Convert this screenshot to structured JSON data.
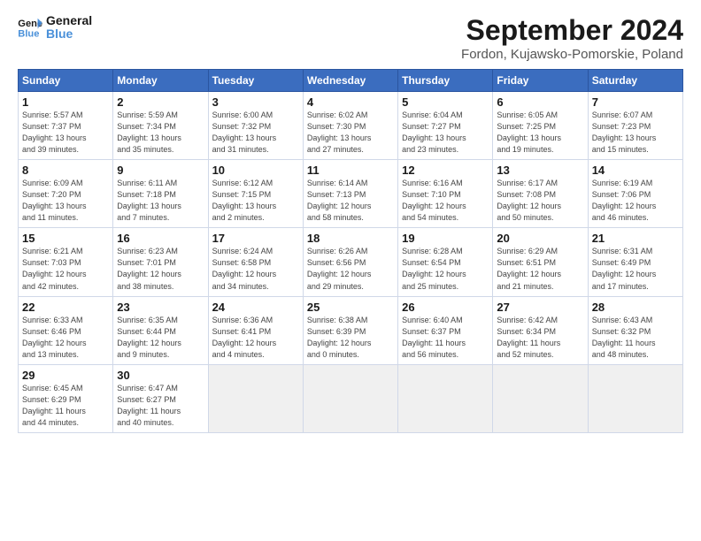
{
  "logo": {
    "line1": "General",
    "line2": "Blue"
  },
  "title": "September 2024",
  "subtitle": "Fordon, Kujawsko-Pomorskie, Poland",
  "weekdays": [
    "Sunday",
    "Monday",
    "Tuesday",
    "Wednesday",
    "Thursday",
    "Friday",
    "Saturday"
  ],
  "weeks": [
    [
      {
        "day": "1",
        "info": "Sunrise: 5:57 AM\nSunset: 7:37 PM\nDaylight: 13 hours\nand 39 minutes."
      },
      {
        "day": "2",
        "info": "Sunrise: 5:59 AM\nSunset: 7:34 PM\nDaylight: 13 hours\nand 35 minutes."
      },
      {
        "day": "3",
        "info": "Sunrise: 6:00 AM\nSunset: 7:32 PM\nDaylight: 13 hours\nand 31 minutes."
      },
      {
        "day": "4",
        "info": "Sunrise: 6:02 AM\nSunset: 7:30 PM\nDaylight: 13 hours\nand 27 minutes."
      },
      {
        "day": "5",
        "info": "Sunrise: 6:04 AM\nSunset: 7:27 PM\nDaylight: 13 hours\nand 23 minutes."
      },
      {
        "day": "6",
        "info": "Sunrise: 6:05 AM\nSunset: 7:25 PM\nDaylight: 13 hours\nand 19 minutes."
      },
      {
        "day": "7",
        "info": "Sunrise: 6:07 AM\nSunset: 7:23 PM\nDaylight: 13 hours\nand 15 minutes."
      }
    ],
    [
      {
        "day": "8",
        "info": "Sunrise: 6:09 AM\nSunset: 7:20 PM\nDaylight: 13 hours\nand 11 minutes."
      },
      {
        "day": "9",
        "info": "Sunrise: 6:11 AM\nSunset: 7:18 PM\nDaylight: 13 hours\nand 7 minutes."
      },
      {
        "day": "10",
        "info": "Sunrise: 6:12 AM\nSunset: 7:15 PM\nDaylight: 13 hours\nand 2 minutes."
      },
      {
        "day": "11",
        "info": "Sunrise: 6:14 AM\nSunset: 7:13 PM\nDaylight: 12 hours\nand 58 minutes."
      },
      {
        "day": "12",
        "info": "Sunrise: 6:16 AM\nSunset: 7:10 PM\nDaylight: 12 hours\nand 54 minutes."
      },
      {
        "day": "13",
        "info": "Sunrise: 6:17 AM\nSunset: 7:08 PM\nDaylight: 12 hours\nand 50 minutes."
      },
      {
        "day": "14",
        "info": "Sunrise: 6:19 AM\nSunset: 7:06 PM\nDaylight: 12 hours\nand 46 minutes."
      }
    ],
    [
      {
        "day": "15",
        "info": "Sunrise: 6:21 AM\nSunset: 7:03 PM\nDaylight: 12 hours\nand 42 minutes."
      },
      {
        "day": "16",
        "info": "Sunrise: 6:23 AM\nSunset: 7:01 PM\nDaylight: 12 hours\nand 38 minutes."
      },
      {
        "day": "17",
        "info": "Sunrise: 6:24 AM\nSunset: 6:58 PM\nDaylight: 12 hours\nand 34 minutes."
      },
      {
        "day": "18",
        "info": "Sunrise: 6:26 AM\nSunset: 6:56 PM\nDaylight: 12 hours\nand 29 minutes."
      },
      {
        "day": "19",
        "info": "Sunrise: 6:28 AM\nSunset: 6:54 PM\nDaylight: 12 hours\nand 25 minutes."
      },
      {
        "day": "20",
        "info": "Sunrise: 6:29 AM\nSunset: 6:51 PM\nDaylight: 12 hours\nand 21 minutes."
      },
      {
        "day": "21",
        "info": "Sunrise: 6:31 AM\nSunset: 6:49 PM\nDaylight: 12 hours\nand 17 minutes."
      }
    ],
    [
      {
        "day": "22",
        "info": "Sunrise: 6:33 AM\nSunset: 6:46 PM\nDaylight: 12 hours\nand 13 minutes."
      },
      {
        "day": "23",
        "info": "Sunrise: 6:35 AM\nSunset: 6:44 PM\nDaylight: 12 hours\nand 9 minutes."
      },
      {
        "day": "24",
        "info": "Sunrise: 6:36 AM\nSunset: 6:41 PM\nDaylight: 12 hours\nand 4 minutes."
      },
      {
        "day": "25",
        "info": "Sunrise: 6:38 AM\nSunset: 6:39 PM\nDaylight: 12 hours\nand 0 minutes."
      },
      {
        "day": "26",
        "info": "Sunrise: 6:40 AM\nSunset: 6:37 PM\nDaylight: 11 hours\nand 56 minutes."
      },
      {
        "day": "27",
        "info": "Sunrise: 6:42 AM\nSunset: 6:34 PM\nDaylight: 11 hours\nand 52 minutes."
      },
      {
        "day": "28",
        "info": "Sunrise: 6:43 AM\nSunset: 6:32 PM\nDaylight: 11 hours\nand 48 minutes."
      }
    ],
    [
      {
        "day": "29",
        "info": "Sunrise: 6:45 AM\nSunset: 6:29 PM\nDaylight: 11 hours\nand 44 minutes."
      },
      {
        "day": "30",
        "info": "Sunrise: 6:47 AM\nSunset: 6:27 PM\nDaylight: 11 hours\nand 40 minutes."
      },
      {
        "day": "",
        "info": ""
      },
      {
        "day": "",
        "info": ""
      },
      {
        "day": "",
        "info": ""
      },
      {
        "day": "",
        "info": ""
      },
      {
        "day": "",
        "info": ""
      }
    ]
  ]
}
